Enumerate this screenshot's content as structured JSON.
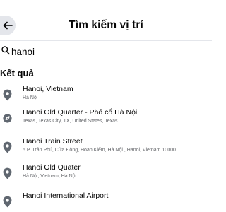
{
  "header": {
    "title": "Tìm kiếm vị trí"
  },
  "search": {
    "value": "hanoi"
  },
  "results_section": {
    "title": "Kết quả"
  },
  "results": [
    {
      "name": "Hanoi, Vietnam",
      "subtitle": "Hà Nội",
      "icon": "location-pin-icon"
    },
    {
      "name": "Hanoi Old Quarter - Phố cổ Hà Nội",
      "subtitle": "Texas, Texas City, TX, United States, Texas",
      "icon": "leaf-icon"
    },
    {
      "name": "Hanoi Train Street",
      "subtitle": "5 P. Trần Phú, Cửa Đông, Hoàn Kiếm, Hà Nội , Hanoi, Vietnam 10000",
      "icon": "location-pin-icon"
    },
    {
      "name": "Hanoi Old Quater",
      "subtitle": "Hà Nội, Vietnam, Hà Nội",
      "icon": "location-pin-icon"
    },
    {
      "name": "Hanoi International Airport",
      "subtitle": "",
      "icon": "location-pin-icon"
    }
  ]
}
